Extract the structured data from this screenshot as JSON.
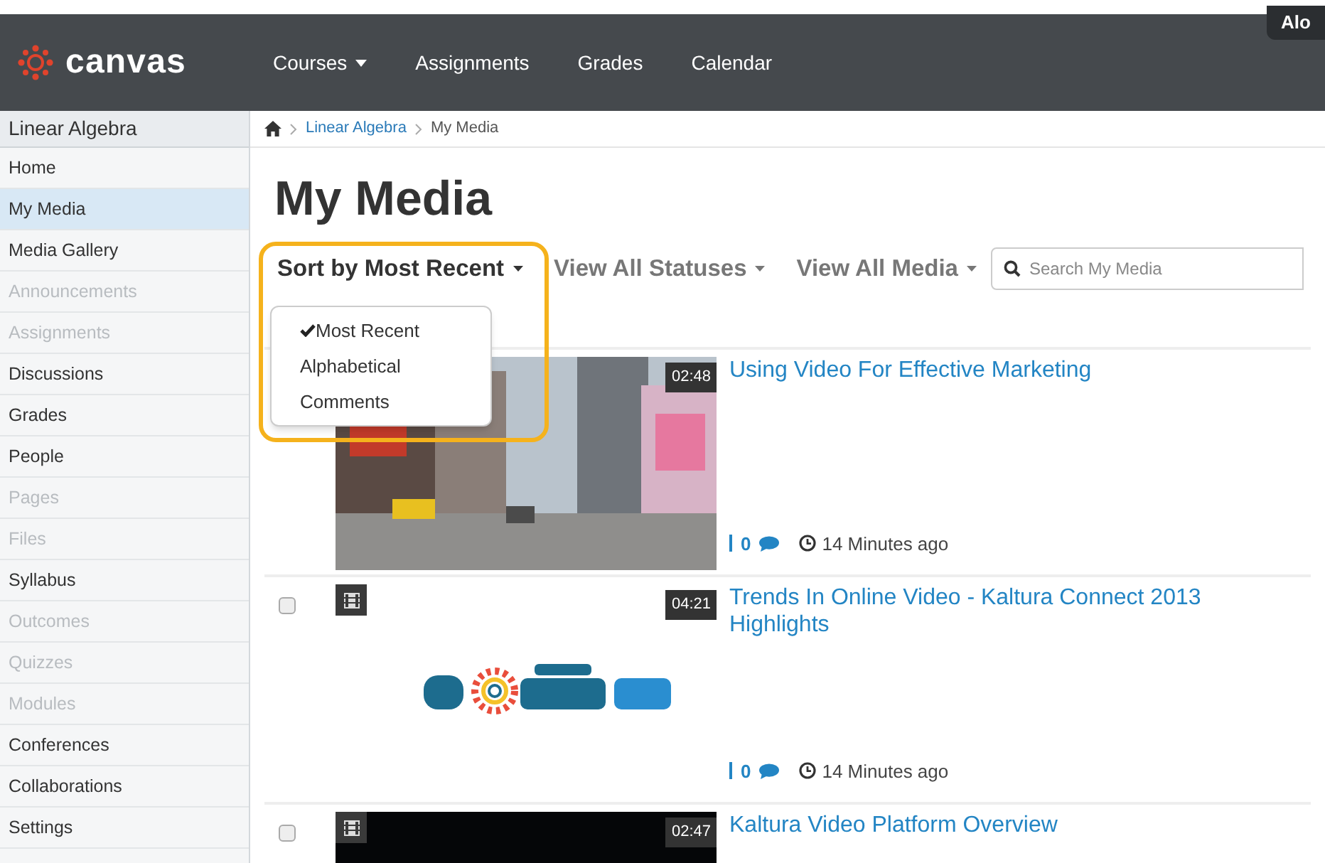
{
  "header": {
    "logo_text": "canvas",
    "user_button": "Alo",
    "nav": [
      {
        "label": "Courses",
        "has_menu": true
      },
      {
        "label": "Assignments",
        "has_menu": false
      },
      {
        "label": "Grades",
        "has_menu": false
      },
      {
        "label": "Calendar",
        "has_menu": false
      }
    ]
  },
  "sidebar": {
    "course": "Linear Algebra",
    "items": [
      {
        "label": "Home",
        "selected": false,
        "disabled": false
      },
      {
        "label": "My Media",
        "selected": true,
        "disabled": false
      },
      {
        "label": "Media Gallery",
        "selected": false,
        "disabled": false
      },
      {
        "label": "Announcements",
        "selected": false,
        "disabled": true
      },
      {
        "label": "Assignments",
        "selected": false,
        "disabled": true
      },
      {
        "label": "Discussions",
        "selected": false,
        "disabled": false
      },
      {
        "label": "Grades",
        "selected": false,
        "disabled": false
      },
      {
        "label": "People",
        "selected": false,
        "disabled": false
      },
      {
        "label": "Pages",
        "selected": false,
        "disabled": true
      },
      {
        "label": "Files",
        "selected": false,
        "disabled": true
      },
      {
        "label": "Syllabus",
        "selected": false,
        "disabled": false
      },
      {
        "label": "Outcomes",
        "selected": false,
        "disabled": true
      },
      {
        "label": "Quizzes",
        "selected": false,
        "disabled": true
      },
      {
        "label": "Modules",
        "selected": false,
        "disabled": true
      },
      {
        "label": "Conferences",
        "selected": false,
        "disabled": false
      },
      {
        "label": "Collaborations",
        "selected": false,
        "disabled": false
      },
      {
        "label": "Settings",
        "selected": false,
        "disabled": false
      }
    ]
  },
  "breadcrumb": [
    "Linear Algebra",
    "My Media"
  ],
  "title": "My Media",
  "filters": [
    {
      "label": "Sort by Most Recent",
      "selected": true
    },
    {
      "label": "View All Statuses",
      "selected": false
    },
    {
      "label": "View All Media",
      "selected": false
    }
  ],
  "search": {
    "placeholder": "Search My Media"
  },
  "sort_menu": {
    "items": [
      {
        "label": "Most Recent",
        "checked": true
      },
      {
        "label": "Alphabetical",
        "checked": false
      },
      {
        "label": "Comments",
        "checked": false
      }
    ]
  },
  "media": [
    {
      "duration": "02:48",
      "title": "Using Video For Effective Marketing",
      "comments": "0",
      "time": "14 Minutes ago"
    },
    {
      "checked": false,
      "duration": "04:21",
      "title": "Trends In Online Video - Kaltura Connect 2013 Highlights",
      "comments": "0",
      "time": "14 Minutes ago"
    },
    {
      "checked": false,
      "duration": "02:47",
      "title": "Kaltura Video Platform Overview"
    }
  ]
}
